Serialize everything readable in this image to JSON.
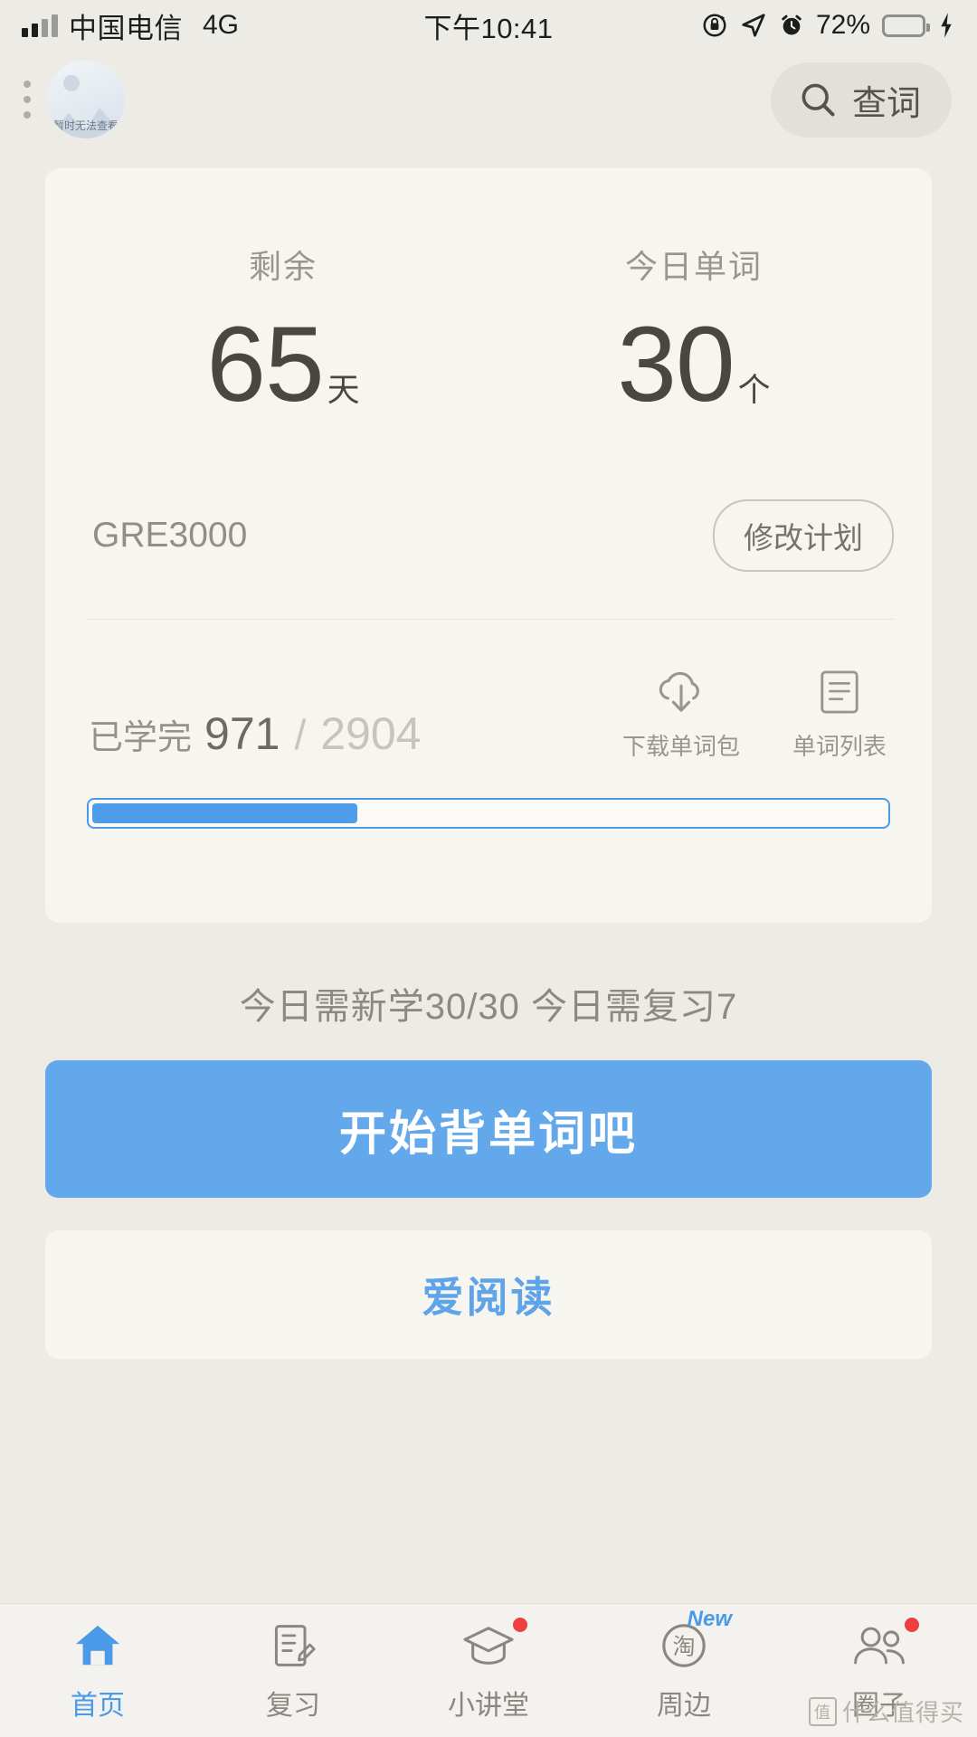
{
  "status_bar": {
    "carrier": "中国电信",
    "network": "4G",
    "time": "下午10:41",
    "battery_percent": "72%",
    "icons": [
      "rotation-lock-icon",
      "location-arrow-icon",
      "alarm-clock-icon",
      "battery-icon",
      "charging-bolt-icon"
    ]
  },
  "header": {
    "menu_icon": "more-vertical-icon",
    "avatar_caption": "暂时无法查看",
    "search_label": "查词"
  },
  "card": {
    "stats": [
      {
        "caption": "剩余",
        "value": "65",
        "unit": "天"
      },
      {
        "caption": "今日单词",
        "value": "30",
        "unit": "个"
      }
    ],
    "plan_name": "GRE3000",
    "edit_plan_label": "修改计划",
    "progress": {
      "label": "已学完",
      "done": "971",
      "separator": "/",
      "total": "2904",
      "percent": 33.4
    },
    "actions": [
      {
        "icon": "cloud-download-icon",
        "label": "下载单词包"
      },
      {
        "icon": "word-list-icon",
        "label": "单词列表"
      }
    ],
    "progress_color": "#4f9ce8"
  },
  "today": {
    "summary": "今日需新学30/30  今日需复习7",
    "start_button": "开始背单词吧",
    "read_card": "爱阅读",
    "accent_color": "#62a8ea"
  },
  "tabs": [
    {
      "label": "首页",
      "icon": "home-icon",
      "active": true,
      "badge": ""
    },
    {
      "label": "复习",
      "icon": "notebook-pen-icon",
      "active": false,
      "badge": ""
    },
    {
      "label": "小讲堂",
      "icon": "graduation-cap-icon",
      "active": false,
      "badge": "dot"
    },
    {
      "label": "周边",
      "icon": "taobao-circle-icon",
      "active": false,
      "badge": "New"
    },
    {
      "label": "圈子",
      "icon": "people-group-icon",
      "active": false,
      "badge": "dot"
    }
  ],
  "watermark": {
    "mark": "值",
    "text": "什么值得买"
  }
}
